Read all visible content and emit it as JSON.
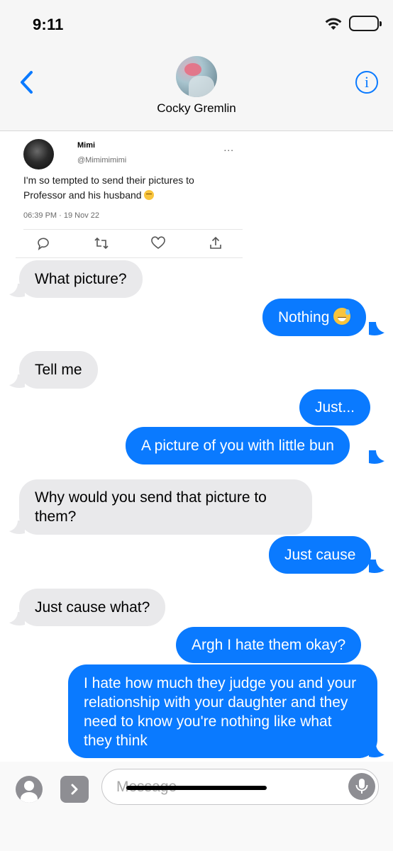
{
  "status_bar": {
    "time": "9:11",
    "battery_level": 0.45
  },
  "header": {
    "contact_name": "Cocky Gremlin",
    "back_icon": "chevron-left-icon",
    "info_icon": "info-icon",
    "accent_color": "#0a7aff"
  },
  "tweet": {
    "name": "Mimi",
    "handle": "@Mimimimimi",
    "more": "...",
    "text": "I'm so tempted to send their pictures to Professor and his husband",
    "text_emoji": "grimace-emoji",
    "timestamp": "06:39 PM · 19 Nov 22",
    "actions": [
      "reply-icon",
      "retweet-icon",
      "like-icon",
      "share-icon"
    ]
  },
  "messages": [
    {
      "side": "in",
      "text": "What picture?"
    },
    {
      "side": "out",
      "text": "Nothing",
      "emoji": "sweat-smile-emoji"
    },
    {
      "side": "in",
      "text": "Tell me"
    },
    {
      "side": "out",
      "text": "Just..."
    },
    {
      "side": "out",
      "text": "A picture of you with little bun"
    },
    {
      "side": "in",
      "text": "Why would you send that picture to them?"
    },
    {
      "side": "out",
      "text": "Just cause"
    },
    {
      "side": "in",
      "text": "Just cause what?"
    },
    {
      "side": "out",
      "text": "Argh I hate them okay?"
    },
    {
      "side": "out",
      "text": "I hate how much they judge you and your relationship with your daughter and they need to know you're nothing like what they think"
    }
  ],
  "input_bar": {
    "placeholder": "Message",
    "apps_icon": "person-icon",
    "expand_icon": "chevron-right-icon",
    "mic_icon": "microphone-icon"
  },
  "colors": {
    "incoming_bubble": "#e9e9eb",
    "outgoing_bubble": "#0a7aff"
  }
}
